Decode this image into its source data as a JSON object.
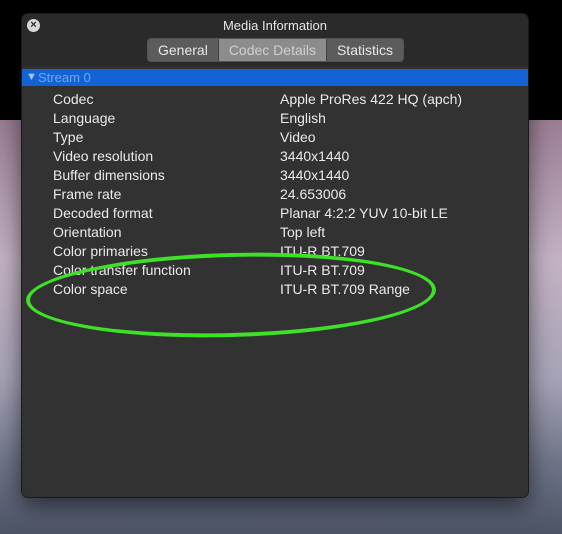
{
  "window": {
    "title": "Media Information",
    "close_icon": "close-icon"
  },
  "tabs": [
    {
      "label": "General",
      "active": false
    },
    {
      "label": "Codec Details",
      "active": true
    },
    {
      "label": "Statistics",
      "active": false
    }
  ],
  "stream": {
    "label": "Stream 0",
    "icon": "disclosure-triangle-icon"
  },
  "properties": [
    {
      "key": "Codec",
      "value": "Apple ProRes 422 HQ (apch)"
    },
    {
      "key": "Language",
      "value": "English"
    },
    {
      "key": "Type",
      "value": "Video"
    },
    {
      "key": "Video resolution",
      "value": "3440x1440"
    },
    {
      "key": "Buffer dimensions",
      "value": "3440x1440"
    },
    {
      "key": "Frame rate",
      "value": "24.653006"
    },
    {
      "key": "Decoded format",
      "value": "Planar 4:2:2 YUV 10-bit LE"
    },
    {
      "key": "Orientation",
      "value": "Top left"
    },
    {
      "key": "Color primaries",
      "value": "ITU-R BT.709"
    },
    {
      "key": "Color transfer function",
      "value": "ITU-R BT.709"
    },
    {
      "key": "Color space",
      "value": "ITU-R BT.709 Range"
    }
  ],
  "colors": {
    "selection": "#1463d6",
    "annotation": "#3ee028"
  }
}
